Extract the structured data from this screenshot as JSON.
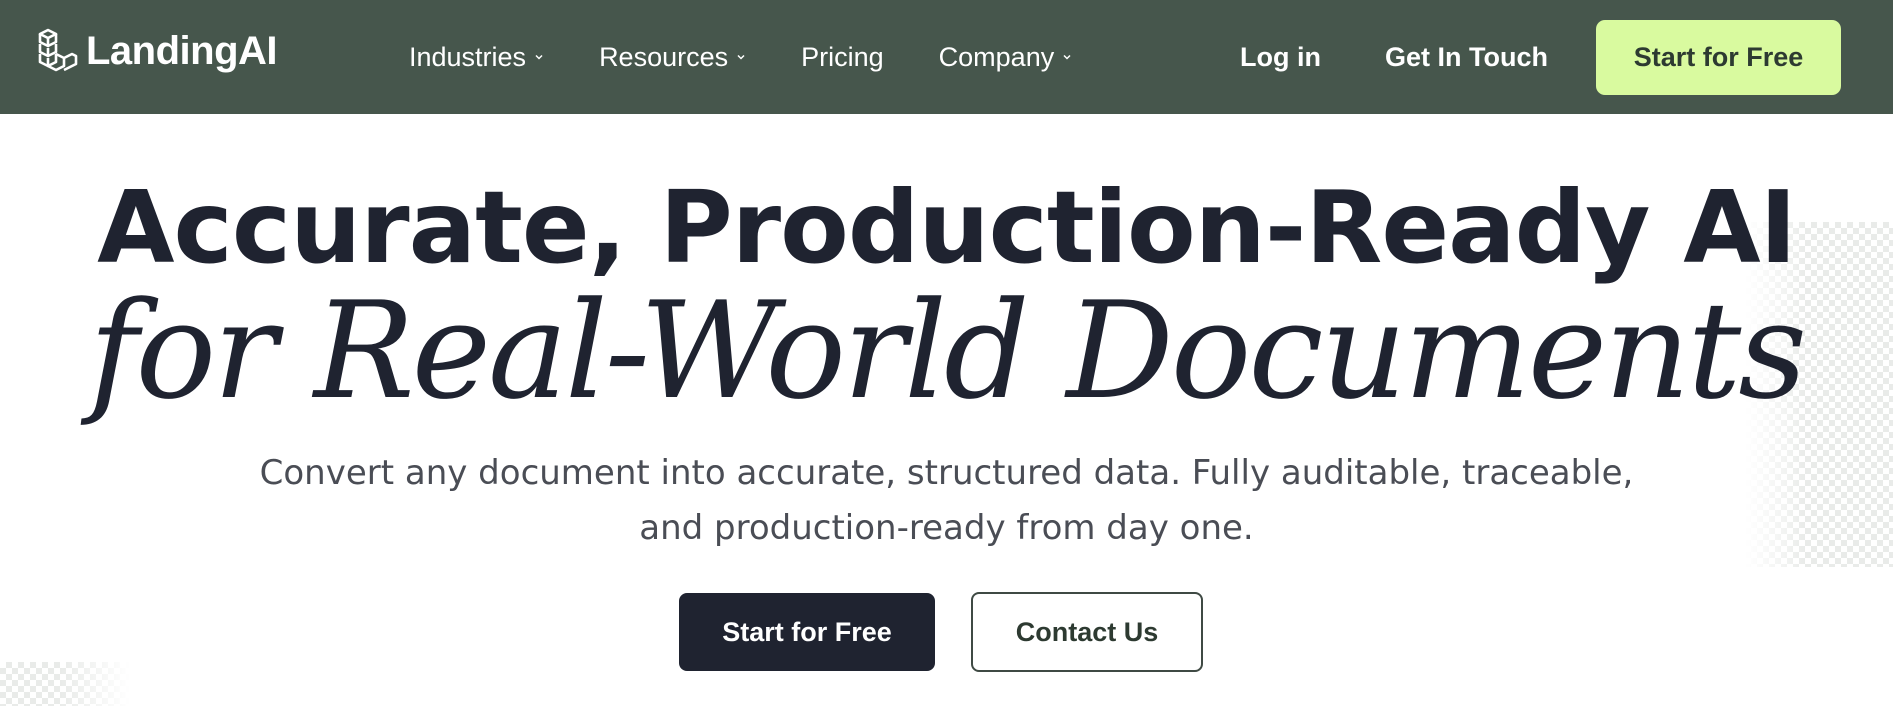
{
  "brand": {
    "name": "LandingAI",
    "logo_icon": "stacked-cubes-icon"
  },
  "nav": {
    "items": [
      {
        "label": "Industries",
        "has_dropdown": true
      },
      {
        "label": "Resources",
        "has_dropdown": true
      },
      {
        "label": "Pricing",
        "has_dropdown": false
      },
      {
        "label": "Company",
        "has_dropdown": true
      }
    ],
    "login_label": "Log in",
    "contact_label": "Get In Touch",
    "cta_label": "Start for Free"
  },
  "hero": {
    "title_line1": "Accurate, Production-Ready AI",
    "title_line2": "for Real-World Documents",
    "subtitle_line1": "Convert any document into accurate, structured data. Fully auditable, traceable,",
    "subtitle_line2": "and production-ready from day one.",
    "primary_button": "Start for Free",
    "secondary_button": "Contact Us"
  },
  "colors": {
    "nav_background": "#46564c",
    "cta_background": "#d9fa9f",
    "primary_button": "#1f2330",
    "text_dark": "#1f2330"
  }
}
